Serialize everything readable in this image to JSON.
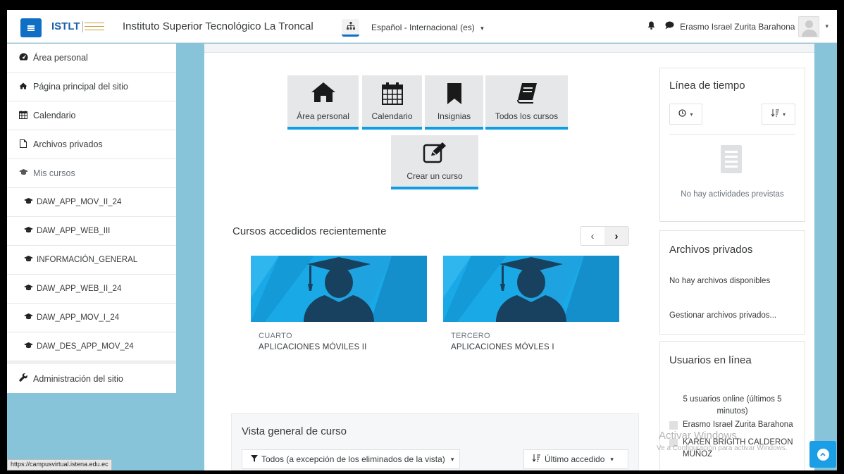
{
  "header": {
    "logo_text": "ISTLT",
    "site_name": "Instituto Superior Tecnológico La Troncal",
    "language": "Español - Internacional (es)",
    "language_caret": "▾",
    "user_name": "Erasmo Israel Zurita Barahona",
    "user_caret": "▾"
  },
  "sidebar": {
    "items": [
      {
        "label": "Área personal",
        "icon": "dashboard-icon"
      },
      {
        "label": "Página principal del sitio",
        "icon": "home-icon"
      },
      {
        "label": "Calendario",
        "icon": "calendar-icon"
      },
      {
        "label": "Archivos privados",
        "icon": "file-icon"
      },
      {
        "label": "Mis cursos",
        "icon": "graduation-cap-icon"
      }
    ],
    "courses": [
      "DAW_APP_MOV_II_24",
      "DAW_APP_WEB_III",
      "INFORMACIÓN_GENERAL",
      "DAW_APP_WEB_II_24",
      "DAW_APP_MOV_I_24",
      "DAW_DES_APP_MOV_24"
    ],
    "admin_label": "Administración del sitio",
    "status_url": "https://campusvirtual.istena.edu.ec"
  },
  "tiles": {
    "dashboard": "Área personal",
    "calendar": "Calendario",
    "badges": "Insignias",
    "all_courses": "Todos los cursos",
    "create_course": "Crear un curso"
  },
  "recent": {
    "title": "Cursos accedidos recientemente",
    "prev": "‹",
    "next": "›",
    "courses": [
      {
        "category": "CUARTO",
        "name": "APLICACIONES MÓVILES II"
      },
      {
        "category": "TERCERO",
        "name": "APLICACIONES MÓVLES I"
      }
    ]
  },
  "overview": {
    "title": "Vista general de curso",
    "filter": "Todos (a excepción de los eliminados de la vista)",
    "sort": "Último accedido",
    "caret": "▾"
  },
  "timeline": {
    "title": "Línea de tiempo",
    "empty": "No hay actividades previstas",
    "caret": "▾"
  },
  "private_files": {
    "title": "Archivos privados",
    "empty": "No hay archivos disponibles",
    "manage": "Gestionar archivos privados..."
  },
  "online_users": {
    "title": "Usuarios en línea",
    "count": "5 usuarios online (últimos 5 minutos)",
    "users": [
      "Erasmo Israel Zurita Barahona",
      "KAREN BRIGITH CALDERON MUÑOZ"
    ]
  },
  "watermark": {
    "line1": "Activar Windows",
    "line2": "Ve a Configuración para activar Windows."
  },
  "colors": {
    "accent": "#0f6fc5",
    "tile_underline": "#0f9ee2",
    "course_image": "#1aa9e7"
  }
}
